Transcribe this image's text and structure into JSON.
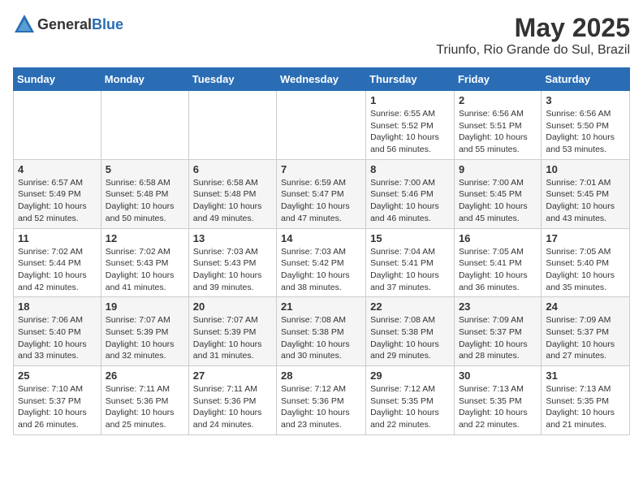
{
  "header": {
    "logo": {
      "text_general": "General",
      "text_blue": "Blue"
    },
    "title": "May 2025",
    "subtitle": "Triunfo, Rio Grande do Sul, Brazil"
  },
  "calendar": {
    "weekdays": [
      "Sunday",
      "Monday",
      "Tuesday",
      "Wednesday",
      "Thursday",
      "Friday",
      "Saturday"
    ],
    "weeks": [
      [
        {
          "day": "",
          "info": ""
        },
        {
          "day": "",
          "info": ""
        },
        {
          "day": "",
          "info": ""
        },
        {
          "day": "",
          "info": ""
        },
        {
          "day": "1",
          "info": "Sunrise: 6:55 AM\nSunset: 5:52 PM\nDaylight: 10 hours\nand 56 minutes."
        },
        {
          "day": "2",
          "info": "Sunrise: 6:56 AM\nSunset: 5:51 PM\nDaylight: 10 hours\nand 55 minutes."
        },
        {
          "day": "3",
          "info": "Sunrise: 6:56 AM\nSunset: 5:50 PM\nDaylight: 10 hours\nand 53 minutes."
        }
      ],
      [
        {
          "day": "4",
          "info": "Sunrise: 6:57 AM\nSunset: 5:49 PM\nDaylight: 10 hours\nand 52 minutes."
        },
        {
          "day": "5",
          "info": "Sunrise: 6:58 AM\nSunset: 5:48 PM\nDaylight: 10 hours\nand 50 minutes."
        },
        {
          "day": "6",
          "info": "Sunrise: 6:58 AM\nSunset: 5:48 PM\nDaylight: 10 hours\nand 49 minutes."
        },
        {
          "day": "7",
          "info": "Sunrise: 6:59 AM\nSunset: 5:47 PM\nDaylight: 10 hours\nand 47 minutes."
        },
        {
          "day": "8",
          "info": "Sunrise: 7:00 AM\nSunset: 5:46 PM\nDaylight: 10 hours\nand 46 minutes."
        },
        {
          "day": "9",
          "info": "Sunrise: 7:00 AM\nSunset: 5:45 PM\nDaylight: 10 hours\nand 45 minutes."
        },
        {
          "day": "10",
          "info": "Sunrise: 7:01 AM\nSunset: 5:45 PM\nDaylight: 10 hours\nand 43 minutes."
        }
      ],
      [
        {
          "day": "11",
          "info": "Sunrise: 7:02 AM\nSunset: 5:44 PM\nDaylight: 10 hours\nand 42 minutes."
        },
        {
          "day": "12",
          "info": "Sunrise: 7:02 AM\nSunset: 5:43 PM\nDaylight: 10 hours\nand 41 minutes."
        },
        {
          "day": "13",
          "info": "Sunrise: 7:03 AM\nSunset: 5:43 PM\nDaylight: 10 hours\nand 39 minutes."
        },
        {
          "day": "14",
          "info": "Sunrise: 7:03 AM\nSunset: 5:42 PM\nDaylight: 10 hours\nand 38 minutes."
        },
        {
          "day": "15",
          "info": "Sunrise: 7:04 AM\nSunset: 5:41 PM\nDaylight: 10 hours\nand 37 minutes."
        },
        {
          "day": "16",
          "info": "Sunrise: 7:05 AM\nSunset: 5:41 PM\nDaylight: 10 hours\nand 36 minutes."
        },
        {
          "day": "17",
          "info": "Sunrise: 7:05 AM\nSunset: 5:40 PM\nDaylight: 10 hours\nand 35 minutes."
        }
      ],
      [
        {
          "day": "18",
          "info": "Sunrise: 7:06 AM\nSunset: 5:40 PM\nDaylight: 10 hours\nand 33 minutes."
        },
        {
          "day": "19",
          "info": "Sunrise: 7:07 AM\nSunset: 5:39 PM\nDaylight: 10 hours\nand 32 minutes."
        },
        {
          "day": "20",
          "info": "Sunrise: 7:07 AM\nSunset: 5:39 PM\nDaylight: 10 hours\nand 31 minutes."
        },
        {
          "day": "21",
          "info": "Sunrise: 7:08 AM\nSunset: 5:38 PM\nDaylight: 10 hours\nand 30 minutes."
        },
        {
          "day": "22",
          "info": "Sunrise: 7:08 AM\nSunset: 5:38 PM\nDaylight: 10 hours\nand 29 minutes."
        },
        {
          "day": "23",
          "info": "Sunrise: 7:09 AM\nSunset: 5:37 PM\nDaylight: 10 hours\nand 28 minutes."
        },
        {
          "day": "24",
          "info": "Sunrise: 7:09 AM\nSunset: 5:37 PM\nDaylight: 10 hours\nand 27 minutes."
        }
      ],
      [
        {
          "day": "25",
          "info": "Sunrise: 7:10 AM\nSunset: 5:37 PM\nDaylight: 10 hours\nand 26 minutes."
        },
        {
          "day": "26",
          "info": "Sunrise: 7:11 AM\nSunset: 5:36 PM\nDaylight: 10 hours\nand 25 minutes."
        },
        {
          "day": "27",
          "info": "Sunrise: 7:11 AM\nSunset: 5:36 PM\nDaylight: 10 hours\nand 24 minutes."
        },
        {
          "day": "28",
          "info": "Sunrise: 7:12 AM\nSunset: 5:36 PM\nDaylight: 10 hours\nand 23 minutes."
        },
        {
          "day": "29",
          "info": "Sunrise: 7:12 AM\nSunset: 5:35 PM\nDaylight: 10 hours\nand 22 minutes."
        },
        {
          "day": "30",
          "info": "Sunrise: 7:13 AM\nSunset: 5:35 PM\nDaylight: 10 hours\nand 22 minutes."
        },
        {
          "day": "31",
          "info": "Sunrise: 7:13 AM\nSunset: 5:35 PM\nDaylight: 10 hours\nand 21 minutes."
        }
      ]
    ]
  }
}
